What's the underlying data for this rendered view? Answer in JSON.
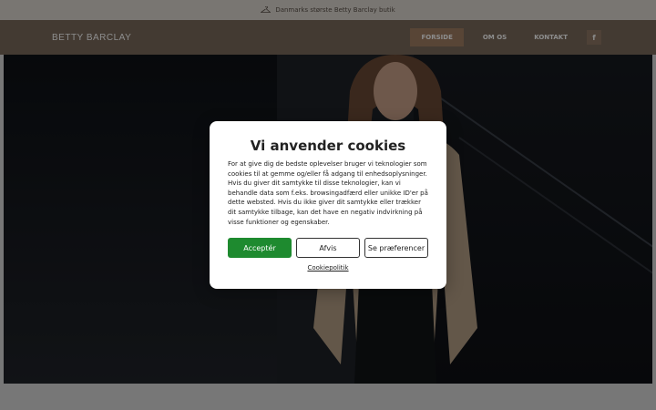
{
  "topbar": {
    "text": "Danmarks største Betty Barclay butik",
    "icon": "hanger-icon"
  },
  "header": {
    "logo": "BETTY BARCLAY",
    "nav": [
      {
        "label": "FORSIDE",
        "active": true
      },
      {
        "label": "OM OS",
        "active": false
      },
      {
        "label": "KONTAKT",
        "active": false
      }
    ],
    "social_icon": "facebook-icon",
    "social_label": "f"
  },
  "cookie": {
    "title": "Vi anvender cookies",
    "body": "For at give dig de bedste oplevelser bruger vi teknologier som cookies til at gemme og/eller få adgang til enhedsoplysninger. Hvis du giver dit samtykke til disse teknologier, kan vi behandle data som f.eks. browsingadfærd eller unikke ID'er på dette websted. Hvis du ikke giver dit samtykke eller trækker dit samtykke tilbage, kan det have en negativ indvirkning på visse funktioner og egenskaber.",
    "accept_label": "Acceptér",
    "decline_label": "Afvis",
    "prefs_label": "Se præferencer",
    "policy_label": "Cookiepolitik"
  },
  "colors": {
    "accent": "#1e8a2f",
    "header_bg": "#7a6a5c",
    "nav_active": "#a07e63"
  }
}
